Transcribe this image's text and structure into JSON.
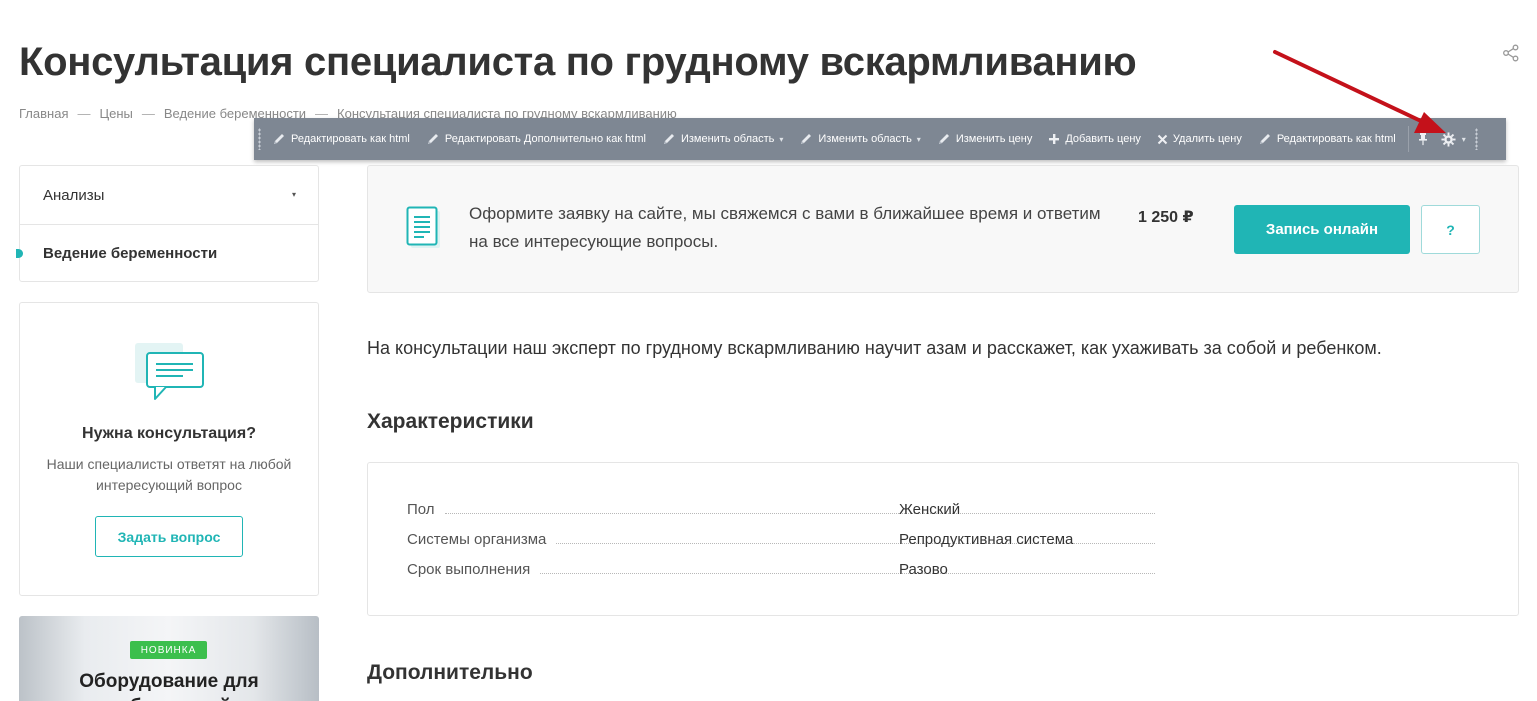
{
  "page": {
    "title": "Консультация специалиста по грудному вскармливанию",
    "breadcrumb": [
      "Главная",
      "Цены",
      "Ведение беременности",
      "Консультация специалиста по грудному вскармливанию"
    ],
    "breadcrumb_separator": "—"
  },
  "toolbar": {
    "items": [
      {
        "label": "Редактировать как html",
        "icon": "pencil-icon"
      },
      {
        "label": "Редактировать Дополнительно как html",
        "icon": "pencil-icon"
      },
      {
        "label": "Изменить область",
        "icon": "pencil-icon",
        "dropdown": true
      },
      {
        "label": "Изменить область",
        "icon": "pencil-icon",
        "dropdown": true
      },
      {
        "label": "Изменить цену",
        "icon": "pencil-icon"
      },
      {
        "label": "Добавить цену",
        "icon": "plus-icon"
      },
      {
        "label": "Удалить цену",
        "icon": "close-icon"
      },
      {
        "label": "Редактировать как html",
        "icon": "pencil-icon"
      }
    ],
    "caret": "▾",
    "background": "#7e8793"
  },
  "sidebar": {
    "menu": [
      {
        "label": "Анализы",
        "dropdown": "▾"
      },
      {
        "label": "Ведение беременности",
        "active": true
      }
    ],
    "consult": {
      "title": "Нужна консультация?",
      "text": "Наши специалисты ответят на любой интересующий вопрос",
      "button": "Задать вопрос"
    },
    "promo": {
      "badge": "НОВИНКА",
      "title": "Оборудование для лабораторий"
    }
  },
  "order": {
    "text": "Оформите заявку на сайте, мы свяжемся с вами в ближайшее время и ответим на все интересующие вопросы.",
    "price": "1 250 ₽",
    "button": "Запись онлайн",
    "question_button": "?"
  },
  "content": {
    "intro": "На консультации наш эксперт по грудному вскармливанию научит азам и расскажет, как ухаживать за собой и ребенком.",
    "characteristics_title": "Характеристики",
    "properties": [
      {
        "name": "Пол",
        "value": "Женский"
      },
      {
        "name": "Системы организма",
        "value": "Репродуктивная система"
      },
      {
        "name": "Срок выполнения",
        "value": "Разово"
      }
    ],
    "additional_title": "Дополнительно"
  },
  "colors": {
    "accent": "#20b5b5",
    "badge": "#3cbf4d",
    "arrow": "#c4111a"
  }
}
